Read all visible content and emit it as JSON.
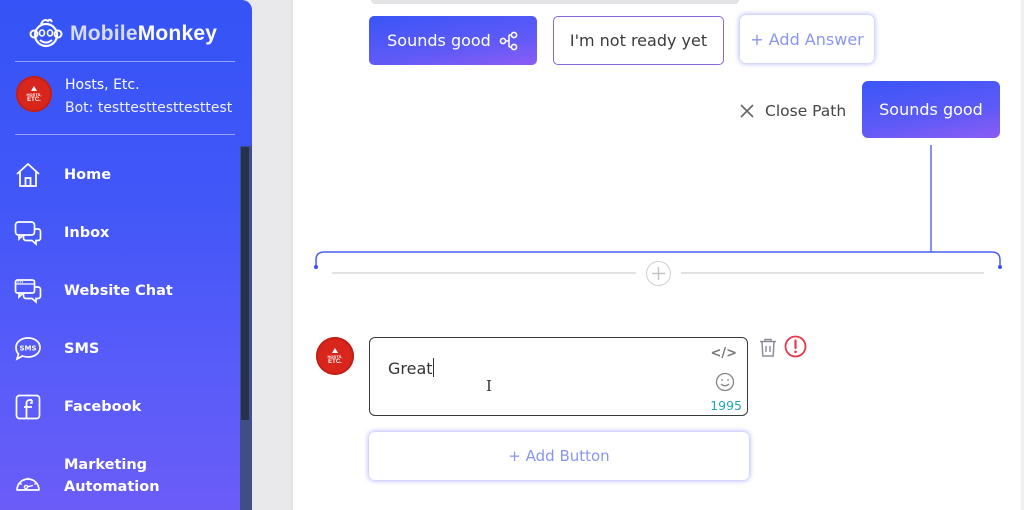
{
  "sidebar": {
    "brand": {
      "light": "Mobile",
      "bold": "Monkey",
      "icon": "monkey-logo-icon"
    },
    "account": {
      "name": "Hosts, Etc.",
      "bot": "Bot: testtesttesttesttest",
      "avatar_line1": "HOSTS,",
      "avatar_line2": "ETC."
    },
    "items": [
      {
        "label": "Home",
        "icon": "home-icon"
      },
      {
        "label": "Inbox",
        "icon": "inbox-icon"
      },
      {
        "label": "Website Chat",
        "icon": "website-chat-icon"
      },
      {
        "label": "SMS",
        "icon": "sms-icon"
      },
      {
        "label": "Facebook",
        "icon": "facebook-icon"
      },
      {
        "label": "Marketing Automation",
        "icon": "marketing-automation-icon"
      }
    ]
  },
  "main": {
    "answers": [
      {
        "label": "Sounds good",
        "icon": "share-icon",
        "selected": true
      },
      {
        "label": "I'm not ready yet",
        "selected": false
      }
    ],
    "add_answer_label": "+ Add Answer",
    "close_path_label": "Close Path",
    "path_label": "Sounds good",
    "message": {
      "text": "Great",
      "char_count": "1995"
    },
    "add_button_label": "+ Add Button"
  },
  "colors": {
    "accent": "#3a55f7",
    "accent_end": "#8c5cf5",
    "char_count": "#20a6b8",
    "alert": "#e8374a",
    "brand_red": "#d9261c"
  }
}
